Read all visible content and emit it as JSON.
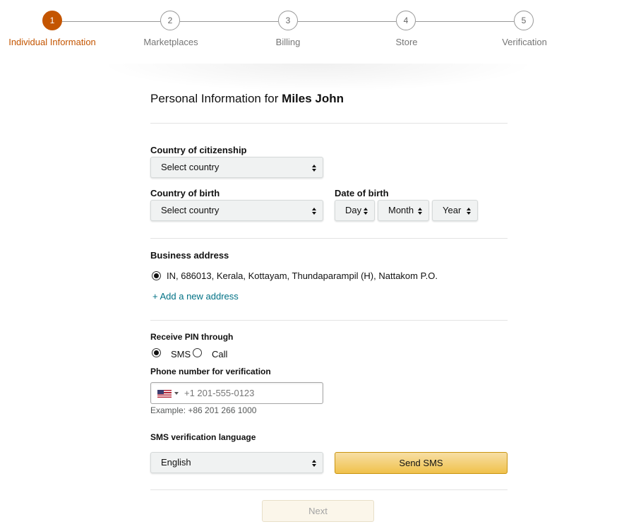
{
  "stepper": {
    "steps": [
      {
        "number": "1",
        "label": "Individual Information"
      },
      {
        "number": "2",
        "label": "Marketplaces"
      },
      {
        "number": "3",
        "label": "Billing"
      },
      {
        "number": "4",
        "label": "Store"
      },
      {
        "number": "5",
        "label": "Verification"
      }
    ],
    "active_step": 1,
    "active_color": "#c45500"
  },
  "form": {
    "heading_prefix": "Personal Information for ",
    "heading_name": "Miles John",
    "citizenship": {
      "label": "Country of citizenship",
      "value": "Select country"
    },
    "birth_country": {
      "label": "Country of birth",
      "value": "Select country"
    },
    "date_of_birth": {
      "label": "Date of birth",
      "day": "Day",
      "month": "Month",
      "year": "Year"
    },
    "business_address": {
      "label": "Business address",
      "selected_address": "IN, 686013, Kerala, Kottayam, Thundaparampil (H), Nattakom P.O.",
      "add_link": "+ Add a new address"
    },
    "pin": {
      "label": "Receive PIN through",
      "options": [
        "SMS",
        "Call"
      ],
      "selected": "SMS"
    },
    "phone": {
      "label": "Phone number for verification",
      "placeholder": "+1 201-555-0123",
      "example": "Example: +86 201 266 1000",
      "flag_icon": "us-flag-icon"
    },
    "sms_language": {
      "label": "SMS verification language",
      "value": "English"
    },
    "send_sms_label": "Send SMS",
    "next_label": "Next",
    "link_color": "#007185",
    "button_color": "#f0c14b"
  }
}
